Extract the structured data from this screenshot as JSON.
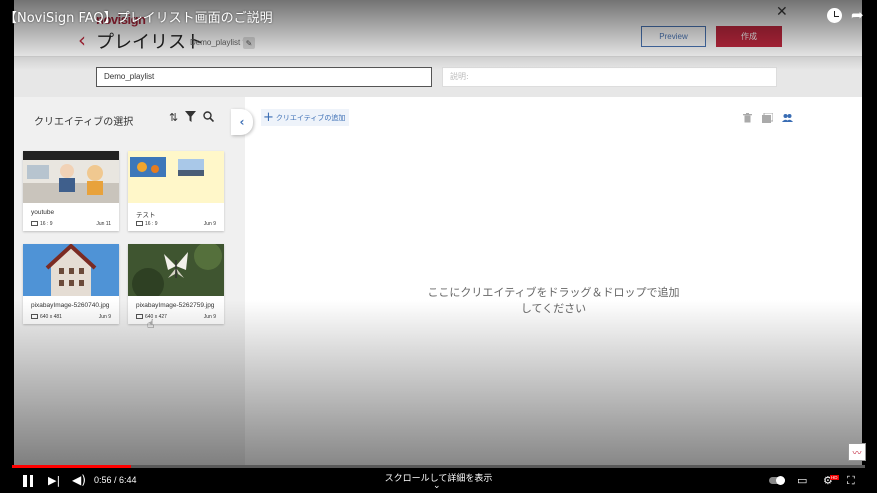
{
  "video": {
    "title": "【NoviSign FAQ】プレイリスト画面のご説明",
    "time": "0:56 / 6:44",
    "progress_fraction": 0.139,
    "scroll_hint": "スクロールして詳細を表示"
  },
  "app": {
    "logo": "novisign",
    "title": "プレイリスト",
    "playlist_name": "Demo_playlist *",
    "preview_label": "Preview",
    "create_label": "作成",
    "name_value": "Demo_playlist",
    "desc_placeholder": "説明:"
  },
  "left_panel": {
    "title": "クリエイティブの選択",
    "cards": [
      {
        "name": "youtube",
        "meta": "16 : 9",
        "date": "Jun 11"
      },
      {
        "name": "テスト",
        "meta": "16 : 9",
        "date": "Jun 9"
      },
      {
        "name": "pixabayImage-5260740.jpg",
        "meta": "640 x 481",
        "date": "Jun 9"
      },
      {
        "name": "pixabayImage-5262759.jpg",
        "meta": "640 x 427",
        "date": "Jun 9"
      }
    ]
  },
  "right_panel": {
    "add_label": "クリエイティブの追加",
    "drop_line1": "ここにクリエイティブをドラッグ＆ドロップで追加",
    "drop_line2": "してください"
  },
  "colors": {
    "brand_red": "#c2283f",
    "accent_blue": "#3a6db4",
    "progress_red": "#ff0000"
  },
  "icons": [
    "close-icon",
    "watch-later-icon",
    "share-icon",
    "chevron-left-icon",
    "edit-icon",
    "sort-icon",
    "filter-icon",
    "search-icon",
    "plus-icon",
    "trash-icon",
    "layers-icon",
    "users-icon",
    "pause-icon",
    "next-icon",
    "volume-icon",
    "autoplay-toggle",
    "subtitles-icon",
    "settings-icon",
    "fullscreen-icon"
  ]
}
